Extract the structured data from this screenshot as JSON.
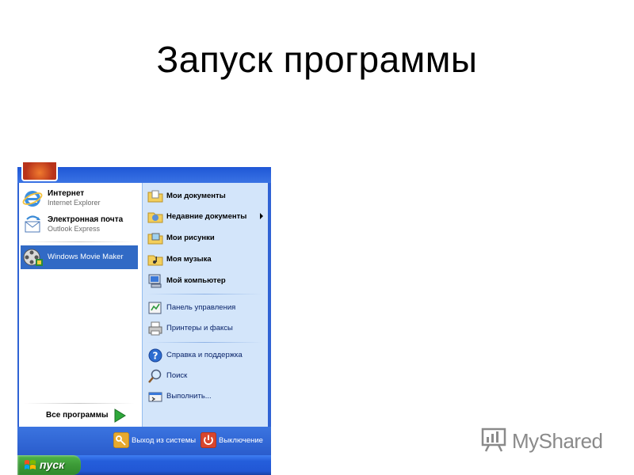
{
  "slide": {
    "title": "Запуск программы"
  },
  "start_menu": {
    "pinned": [
      {
        "title": "Интернет",
        "subtitle": "Internet Explorer",
        "icon": "internet-explorer-icon"
      },
      {
        "title": "Электронная почта",
        "subtitle": "Outlook Express",
        "icon": "outlook-express-icon"
      }
    ],
    "recent": [
      {
        "title": "Windows Movie Maker",
        "icon": "movie-maker-icon",
        "selected": true
      }
    ],
    "all_programs": "Все программы",
    "places": [
      {
        "label": "Мои документы",
        "icon": "my-documents-folder-icon"
      },
      {
        "label": "Недавние документы",
        "icon": "recent-documents-folder-icon",
        "submenu": true
      },
      {
        "label": "Мои рисунки",
        "icon": "my-pictures-folder-icon"
      },
      {
        "label": "Моя музыка",
        "icon": "my-music-folder-icon"
      },
      {
        "label": "Мой компьютер",
        "icon": "my-computer-icon"
      }
    ],
    "system": [
      {
        "label": "Панель управления",
        "icon": "control-panel-icon"
      },
      {
        "label": "Принтеры и факсы",
        "icon": "printers-faxes-icon"
      }
    ],
    "help": [
      {
        "label": "Справка и поддержка",
        "icon": "help-icon"
      },
      {
        "label": "Поиск",
        "icon": "search-icon"
      },
      {
        "label": "Выполнить...",
        "icon": "run-icon"
      }
    ],
    "footer": {
      "logoff": "Выход из системы",
      "shutdown": "Выключение"
    }
  },
  "taskbar": {
    "start_label": "пуск"
  },
  "watermark": {
    "text": "MyShared"
  },
  "colors": {
    "menu_blue": "#2f62d4",
    "selection_blue": "#316ac5",
    "right_pane": "#d3e5fa",
    "start_green": "#3c9a37"
  }
}
